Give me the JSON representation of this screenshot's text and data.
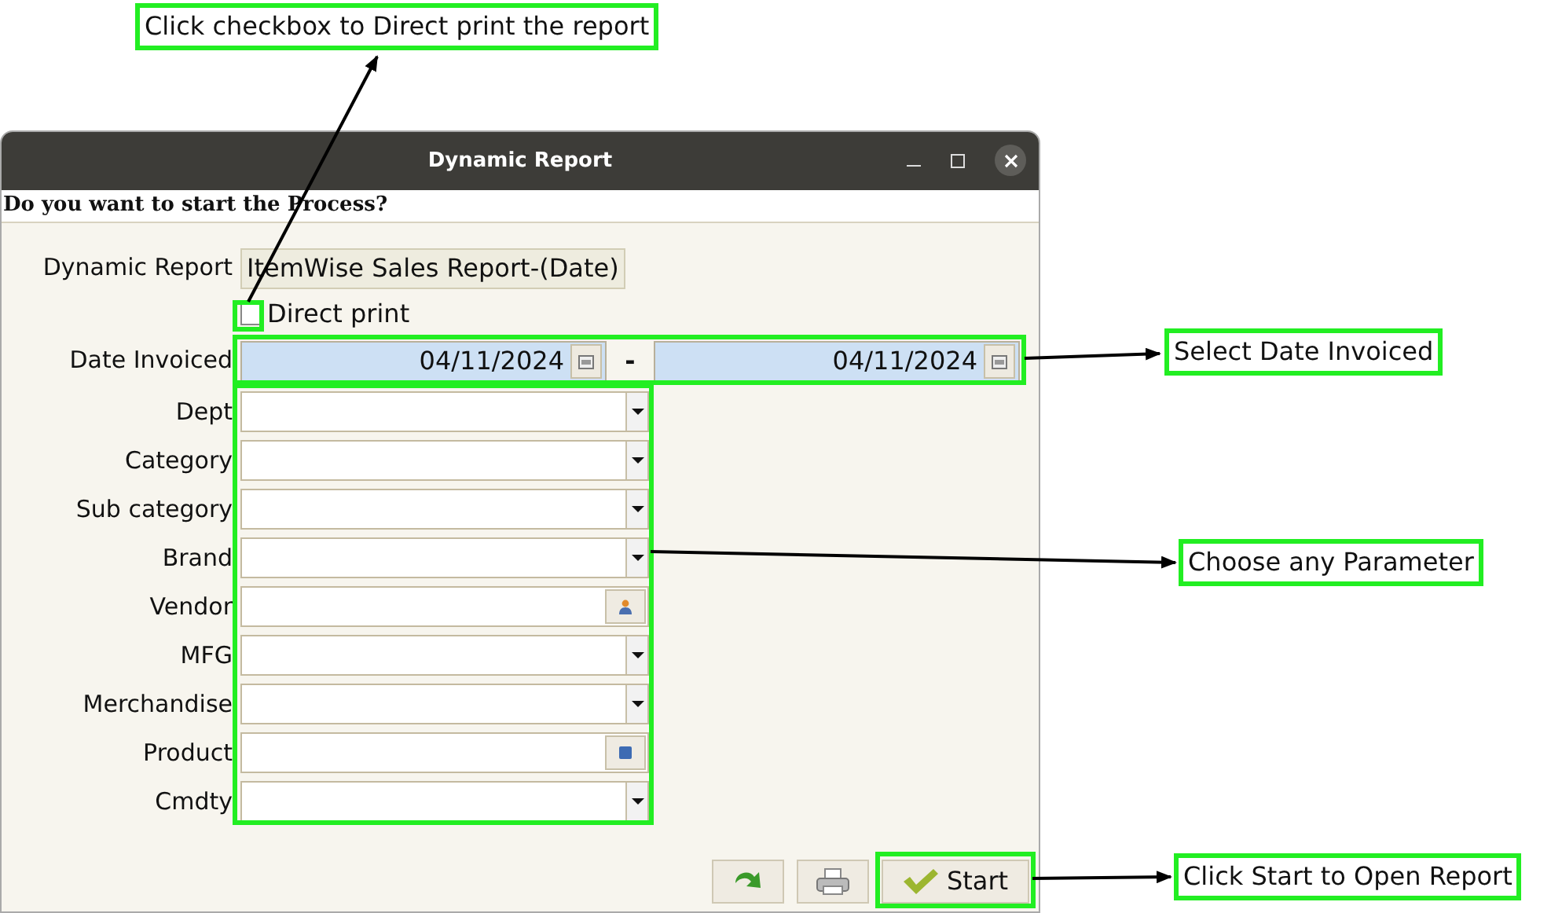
{
  "window": {
    "title": "Dynamic Report"
  },
  "prompt": "Do you want to start the Process?",
  "report": {
    "label": "Dynamic Report",
    "value": "ItemWise Sales Report-(Date)"
  },
  "direct_print": {
    "label": "Direct print",
    "checked": false
  },
  "date_invoiced": {
    "label": "Date Invoiced",
    "from": "04/11/2024",
    "separator": "-",
    "to": "04/11/2024"
  },
  "parameters": [
    {
      "label": "Dept",
      "kind": "dropdown"
    },
    {
      "label": "Category",
      "kind": "dropdown"
    },
    {
      "label": "Sub category",
      "kind": "dropdown"
    },
    {
      "label": "Brand",
      "kind": "dropdown"
    },
    {
      "label": "Vendor",
      "kind": "person-lookup"
    },
    {
      "label": "MFG",
      "kind": "dropdown"
    },
    {
      "label": "Merchandise",
      "kind": "dropdown"
    },
    {
      "label": "Product",
      "kind": "box-lookup"
    },
    {
      "label": "Cmdty",
      "kind": "dropdown"
    }
  ],
  "buttons": [
    {
      "kind": "refresh"
    },
    {
      "kind": "print"
    },
    {
      "kind": "start",
      "label": "Start"
    }
  ],
  "annotations": [
    {
      "text": "Click checkbox to Direct print the report"
    },
    {
      "text": "Select Date Invoiced"
    },
    {
      "text": "Choose any Parameter"
    },
    {
      "text": "Click Start to Open Report"
    }
  ]
}
